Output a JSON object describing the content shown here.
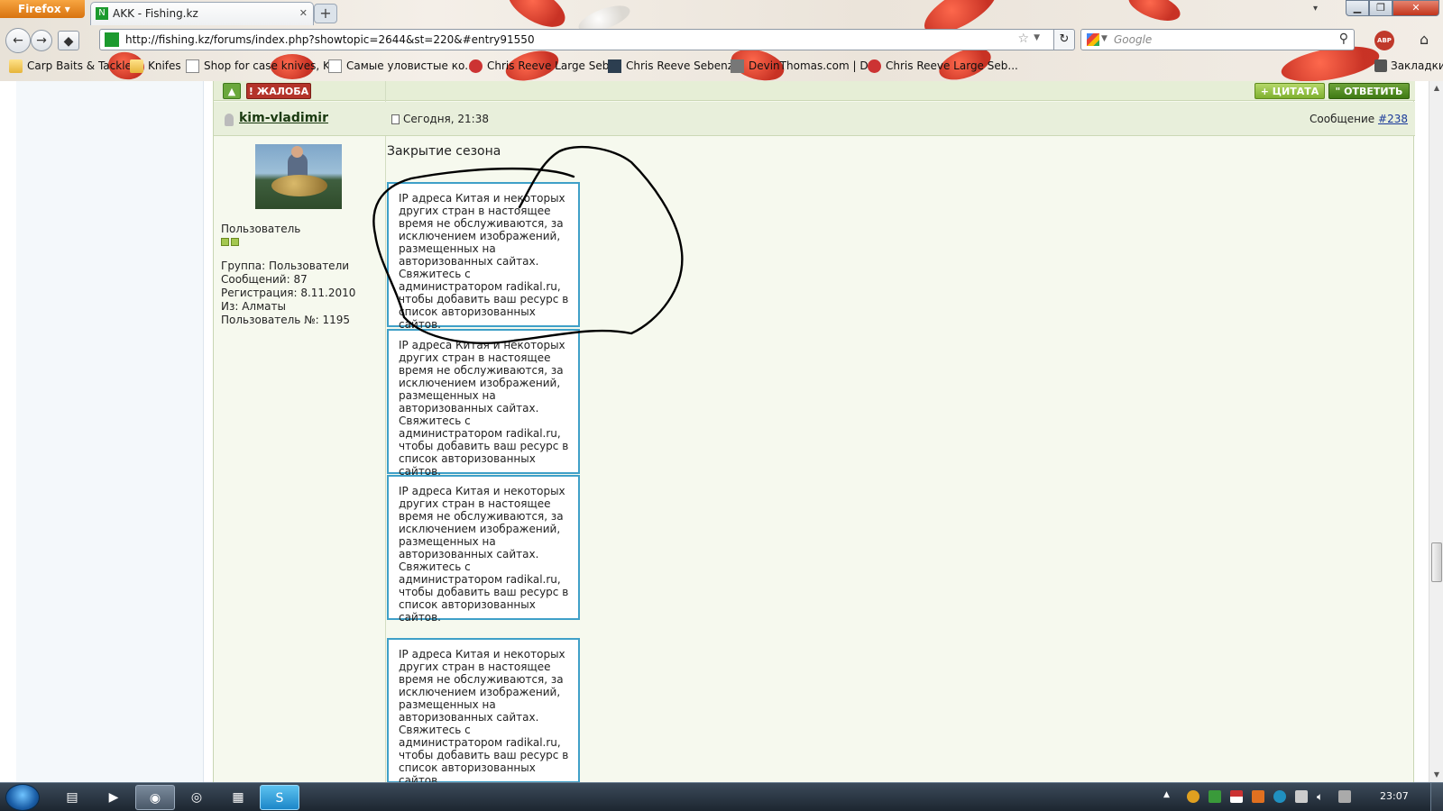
{
  "browser": {
    "menu_button": "Firefox",
    "tab_title": "AKK - Fishing.kz",
    "new_tab": "+",
    "url": "http://fishing.kz/forums/index.php?showtopic=2644&st=220&#entry91550",
    "search_placeholder": "Google",
    "bookmarks": [
      {
        "label": "Carp Baits & Tackle",
        "icon": "folder-icon"
      },
      {
        "label": "Knifes",
        "icon": "folder-icon"
      },
      {
        "label": "Shop for case knives, K...",
        "icon": "page-icon"
      },
      {
        "label": "Самые уловистые ко...",
        "icon": "page-icon"
      },
      {
        "label": "Chris Reeve Large Seb...",
        "icon": "knife-icon"
      },
      {
        "label": "Chris Reeve Sebenza",
        "icon": "xbox-icon"
      },
      {
        "label": "DevinThomas.com | D...",
        "icon": "dt-icon"
      },
      {
        "label": "Chris Reeve Large Seb...",
        "icon": "knife-icon"
      }
    ],
    "bookmarks_menu": "Закладки"
  },
  "forum": {
    "top_buttons": {
      "report": "ЖАЛОБА",
      "quote": "ЦИТАТА",
      "reply": "ОТВЕТИТЬ"
    },
    "post": {
      "username": "kim-vladimir",
      "date": "Сегодня, 21:38",
      "message_label": "Сообщение",
      "message_number": "#238",
      "user_title": "Пользователь",
      "user_info": [
        "Группа: Пользователи",
        "Сообщений: 87",
        "Регистрация: 8.11.2010",
        "Из: Алматы",
        "Пользователь №: 1195"
      ],
      "title": "Закрытие сезона",
      "image_placeholders": [
        "IP адреса Китая и некоторых других стран в настоящее время не обслуживаются, за исключением изображений, размещенных на авторизованных сайтах. Свяжитесь с администратором radikal.ru, чтобы добавить ваш ресурс в список авторизованных сайтов.",
        "IP адреса Китая и некоторых других стран в настоящее время не обслуживаются, за исключением изображений, размещенных на авторизованных сайтах. Свяжитесь с администратором radikal.ru, чтобы добавить ваш ресурс в список авторизованных сайтов.",
        "IP адреса Китая и некоторых других стран в настоящее время не обслуживаются, за исключением изображений, размещенных на авторизованных сайтах. Свяжитесь с администратором radikal.ru, чтобы добавить ваш ресурс в список авторизованных сайтов.",
        "IP адреса Китая и некоторых других стран в настоящее время не обслуживаются, за исключением изображений, размещенных на авторизованных сайтах. Свяжитесь с администратором radikal.ru, чтобы добавить ваш ресурс в список авторизованных сайтов."
      ]
    }
  },
  "taskbar": {
    "clock": "23:07"
  },
  "colors": {
    "accent_green": "#3f7a14",
    "report_red": "#b4342a",
    "image_border": "#3fa0c8",
    "annotation": "#000000"
  }
}
